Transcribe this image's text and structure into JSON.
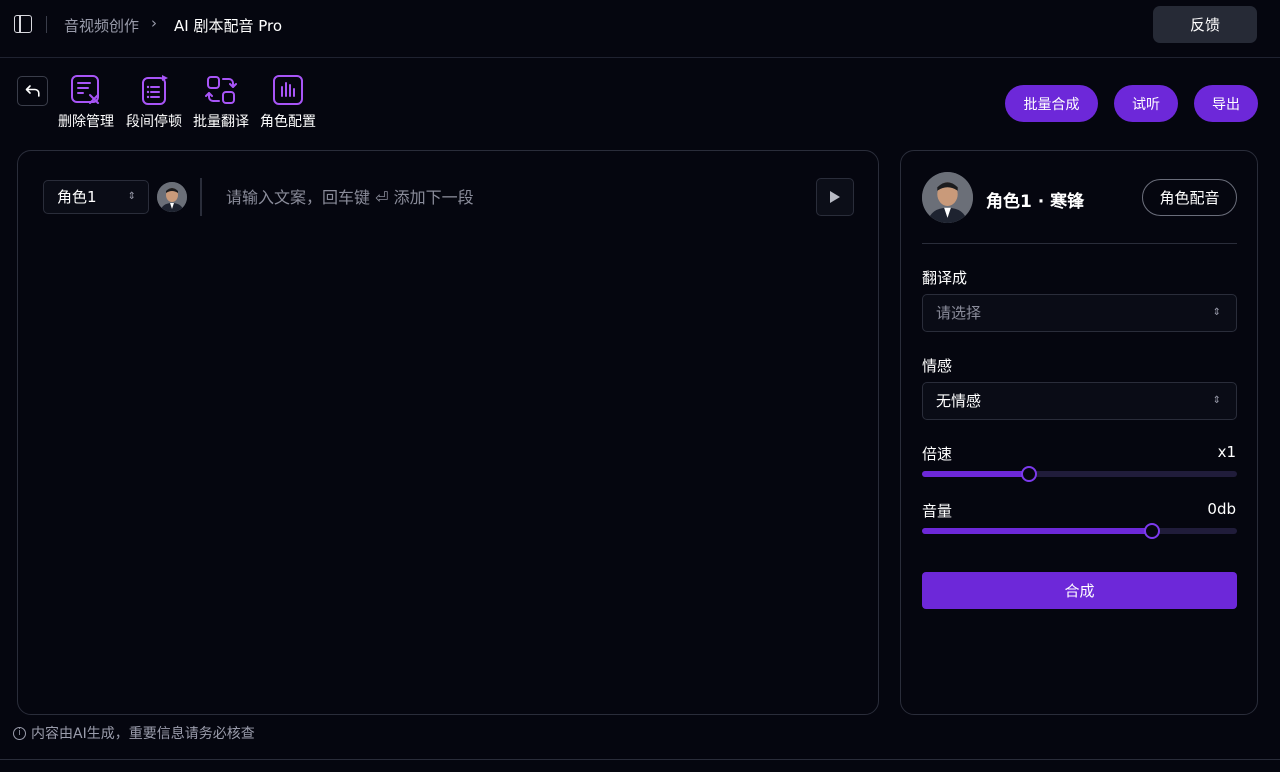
{
  "header": {
    "breadcrumb_parent": "音视频创作",
    "breadcrumb_separator": "›",
    "breadcrumb_current": "AI 剧本配音 Pro",
    "feedback_label": "反馈"
  },
  "toolbar": {
    "tools": [
      {
        "label": "删除管理",
        "icon": "delete-manage-icon"
      },
      {
        "label": "段间停顿",
        "icon": "pause-icon"
      },
      {
        "label": "批量翻译",
        "icon": "translate-icon"
      },
      {
        "label": "角色配置",
        "icon": "role-config-icon"
      }
    ],
    "batch_synth_label": "批量合成",
    "preview_label": "试听",
    "export_label": "导出"
  },
  "editor": {
    "role_select_value": "角色1",
    "text_placeholder": "请输入文案，回车键 ⏎ 添加下一段"
  },
  "role_panel": {
    "role_title": "角色1 · 寒锋",
    "role_voice_label": "角色配音",
    "translate_label": "翻译成",
    "translate_placeholder": "请选择",
    "emotion_label": "情感",
    "emotion_value": "无情感",
    "speed_label": "倍速",
    "speed_value": "x1",
    "speed_level": 0.34,
    "volume_label": "音量",
    "volume_value": "0db",
    "volume_level": 0.73,
    "synth_label": "合成"
  },
  "footer": {
    "notice": "内容由AI生成，重要信息请务必核查"
  },
  "colors": {
    "accent": "#6d28d9",
    "background": "#05060f",
    "border": "#2a2d3a"
  }
}
